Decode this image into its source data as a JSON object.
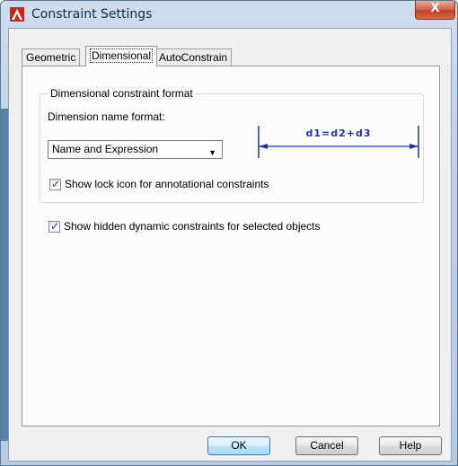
{
  "window": {
    "title": "Constraint Settings",
    "close_label": "X"
  },
  "tabs": [
    {
      "label": "Geometric",
      "active": false
    },
    {
      "label": "Dimensional",
      "active": true
    },
    {
      "label": "AutoConstrain",
      "active": false
    }
  ],
  "dimensional": {
    "group_title": "Dimensional constraint format",
    "name_format_label": "Dimension name format:",
    "name_format_value": "Name and Expression",
    "preview_text": "d1=d2+d3",
    "lock_icon_checkbox": {
      "label": "Show lock icon for annotational constraints",
      "checked": true
    },
    "hidden_constraints_checkbox": {
      "label": "Show hidden dynamic constraints for selected objects",
      "checked": true
    }
  },
  "buttons": {
    "ok": "OK",
    "cancel": "Cancel",
    "help": "Help"
  },
  "colors": {
    "dimension_line": "#2233aa",
    "app_icon": "#d6322a"
  }
}
